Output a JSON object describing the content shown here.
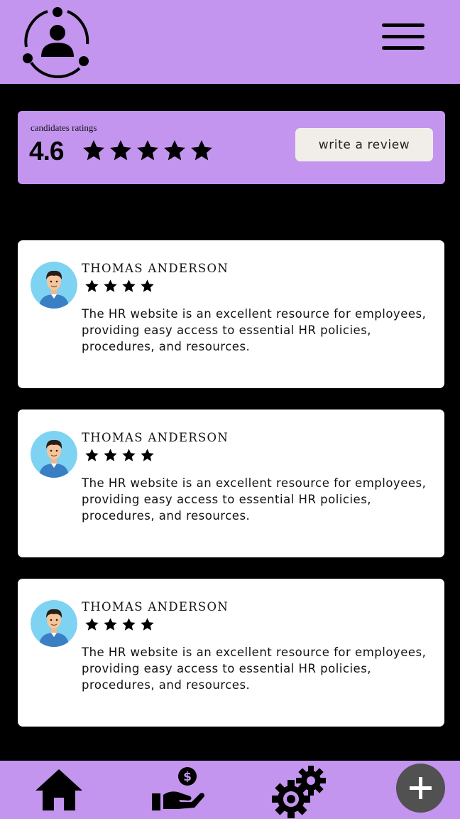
{
  "header": {
    "logo_icon": "people-network-icon",
    "menu_icon": "hamburger-menu-icon"
  },
  "rating_summary": {
    "label": "candidates ratings",
    "value": "4.6",
    "stars": 5,
    "write_review_label": "write a review"
  },
  "reviews": [
    {
      "name": "THOMAS ANDERSON",
      "stars": 4,
      "text": "The HR website is an excellent resource for employees, providing easy access to essential HR policies, procedures, and resources.",
      "avatar_icon": "user-avatar-icon"
    },
    {
      "name": "THOMAS ANDERSON",
      "stars": 4,
      "text": "The HR website is an excellent resource for employees, providing easy access to essential HR policies, procedures, and resources.",
      "avatar_icon": "user-avatar-icon"
    },
    {
      "name": "THOMAS ANDERSON",
      "stars": 4,
      "text": "The HR website is an excellent resource for employees, providing easy access to essential HR policies, procedures, and resources.",
      "avatar_icon": "user-avatar-icon"
    }
  ],
  "bottom_nav": {
    "items": [
      "home-icon",
      "payment-hand-icon",
      "settings-gears-icon",
      "add-icon"
    ]
  },
  "colors": {
    "accent": "#c395ee",
    "background": "#000000",
    "card": "#ffffff",
    "button": "#f1eeea",
    "fab": "#515151"
  }
}
